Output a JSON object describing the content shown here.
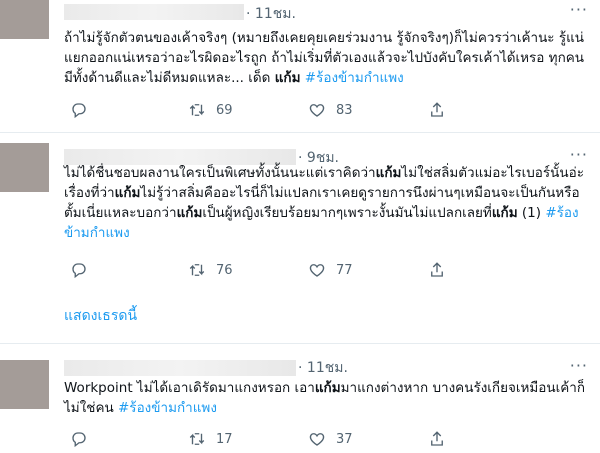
{
  "tweets": [
    {
      "time": "11ชม.",
      "text_parts": [
        {
          "t": "ถ้าไม่รู้จักตัวตนของเค้าจริงๆ (หมายถึงเคยคุยเคยร่วมงาน รู้จักจริงๆ)ก็ไม่ควรว่าเค้านะ รู้แน่แยกออกแน่เหรอว่าอะไรผิดอะไรถูก ถ้าไม่เริ่มที่ตัวเองแล้วจะไปบังคับใครเค้าได้เหรอ ทุกคนมีทั้งด้านดีและไม่ดีหมดแหละ... เด็ด ",
          "style": "plain"
        },
        {
          "t": "แก้ม",
          "style": "bold"
        },
        {
          "t": " ",
          "style": "plain"
        },
        {
          "t": "#ร้องข้ามกำแพง",
          "style": "hashtag"
        }
      ],
      "replies": "",
      "retweets": "69",
      "likes": "83"
    },
    {
      "time": "9ชม.",
      "text_parts": [
        {
          "t": "ไม่ได้ชื่นชอบผลงานใครเป็นพิเศษทั้งนั้นนะแต่เราคิดว่า",
          "style": "plain"
        },
        {
          "t": "แก้ม",
          "style": "bold"
        },
        {
          "t": "ไม่ใช่สลิ่มตัวแม่อะไรเบอร์นั้นอ่ะ เรื่องที่ว่า",
          "style": "plain"
        },
        {
          "t": "แก้ม",
          "style": "bold"
        },
        {
          "t": "ไม่รู้ว่าสลิ่มคืออะไรนี่ก็ไม่แปลกเราเคยดูรายการนึงผ่านๆเหมือนจะเป็นกันหรือตั้มเนี่ยแหละบอกว่า",
          "style": "plain"
        },
        {
          "t": "แก้ม",
          "style": "bold"
        },
        {
          "t": "เป็นผู้หญิงเรียบร้อยมากๆเพราะงั้นมันไม่แปลกเลยที่",
          "style": "plain"
        },
        {
          "t": "แก้ม",
          "style": "bold"
        },
        {
          "t": " (1) ",
          "style": "plain"
        },
        {
          "t": "#ร้องข้ามกำแพง",
          "style": "hashtag"
        }
      ],
      "replies": "",
      "retweets": "76",
      "likes": "77"
    },
    {
      "time": "11ชม.",
      "text_parts": [
        {
          "t": "Workpoint ไม่ได้เอาเดิรัดมาแกงหรอก เอา",
          "style": "plain"
        },
        {
          "t": "แก้ม",
          "style": "bold"
        },
        {
          "t": "มาแกงต่างหาก บางคนรังเกียจเหมือนเค้าก็ไม่ใช่คน ",
          "style": "plain"
        },
        {
          "t": "#ร้องข้ามกำแพง",
          "style": "hashtag"
        }
      ],
      "replies": "",
      "retweets": "17",
      "likes": "37"
    }
  ],
  "show_thread_label": "แสดงเธรดนี้",
  "colors": {
    "accent": "#1d9bf0",
    "muted": "#536471",
    "avatar": "#a49c98",
    "divider": "#e6ecf0"
  }
}
